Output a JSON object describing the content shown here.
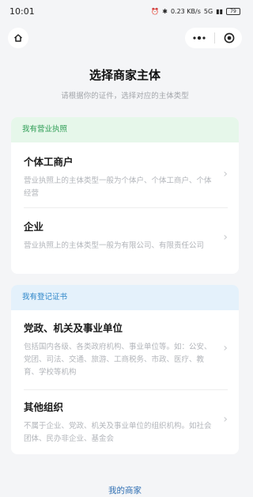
{
  "status_bar": {
    "time": "10:01",
    "indicators": "0.23 KB/s",
    "network": "5G",
    "battery": "79"
  },
  "nav": {
    "home_icon": "home-icon",
    "more_icon": "more-dots-icon",
    "close_icon": "close-target-icon"
  },
  "page": {
    "title": "选择商家主体",
    "subtitle": "请根据你的证件，选择对应的主体类型"
  },
  "groups": [
    {
      "header": "我有营业执照",
      "header_color": "#2f9e56",
      "options": [
        {
          "title": "个体工商户",
          "desc": "营业执照上的主体类型一般为个体户、个体工商户、个体经营"
        },
        {
          "title": "企业",
          "desc": "营业执照上的主体类型一般为有限公司、有限责任公司"
        }
      ]
    },
    {
      "header": "我有登记证书",
      "header_color": "#2e86c9",
      "options": [
        {
          "title": "党政、机关及事业单位",
          "desc": "包括国内各级、各类政府机构、事业单位等。如：公安、党团、司法、交通、旅游、工商税务、市政、医疗、教育、学校等机构"
        },
        {
          "title": "其他组织",
          "desc": "不属于企业、党政、机关及事业单位的组织机构。如社会团体、民办非企业、基金会"
        }
      ]
    }
  ],
  "footer": {
    "link": "我的商家"
  }
}
